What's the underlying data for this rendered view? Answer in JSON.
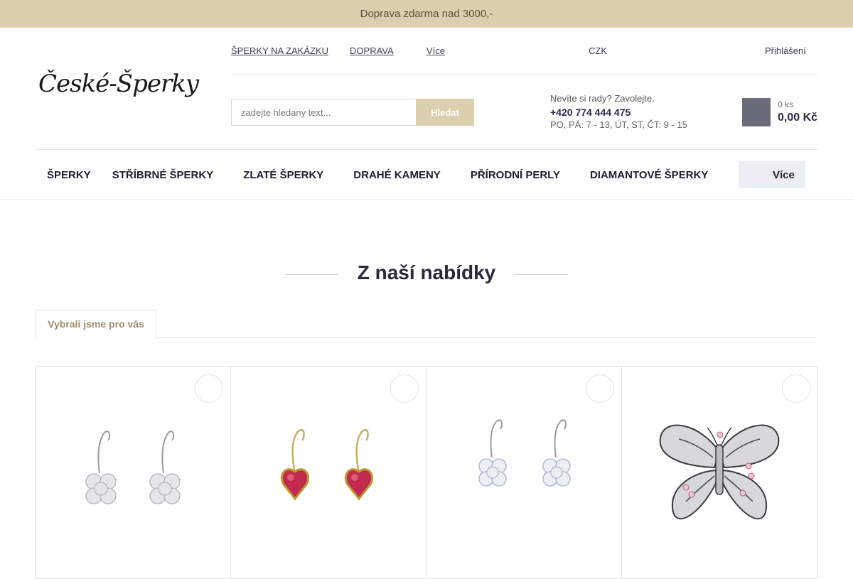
{
  "announcement": {
    "text": "Doprava zdarma nad 3000,-",
    "close_glyph": ""
  },
  "brand": {
    "logo_text": "České-Šperky"
  },
  "top_links": [
    "ŠPERKY NA ZAKÁZKU",
    "DOPRAVA"
  ],
  "top_more": {
    "icon": "",
    "label": "Více"
  },
  "currency": {
    "icon": "",
    "label": "CZK",
    "caret": ""
  },
  "account": {
    "icon1": "",
    "icon2": "",
    "label": "Přihlášení"
  },
  "search": {
    "placeholder": "zadejte hledaný text...",
    "button": "Hledat"
  },
  "contact": {
    "icon": "",
    "question": "Nevíte si rady? Zavolejte.",
    "phone": "+420 774 444 475",
    "hours": "PO, PÁ: 7 - 13, ÚT, ST, ČT: 9 - 15"
  },
  "cart": {
    "icon": "",
    "count": "0 ks",
    "total": "0,00 Kč"
  },
  "nav": {
    "items": [
      {
        "label": "ŠPERKY",
        "arrow": ""
      },
      {
        "label": "STŘÍBRNÉ ŠPERKY",
        "arrow": ""
      },
      {
        "label": "ZLATÉ ŠPERKY",
        "arrow": ""
      },
      {
        "label": "DRAHÉ KAMENY",
        "arrow": ""
      },
      {
        "label": "PŘÍRODNÍ PERLY",
        "arrow": ""
      },
      {
        "label": "DIAMANTOVÉ ŠPERKY",
        "arrow": ""
      }
    ],
    "more": {
      "icon": "",
      "label": "Více"
    }
  },
  "section": {
    "title": "Z naší nabídky",
    "tab": "Vybrali jsme pro vás"
  },
  "products": [
    {
      "fav_icon": ""
    },
    {
      "fav_icon": ""
    },
    {
      "fav_icon": ""
    },
    {
      "fav_icon": ""
    }
  ],
  "colors": {
    "accent": "#dccfae",
    "accent_text": "#a08e68",
    "cart_bg": "#6a6c7a",
    "more_bg": "#eceef6"
  }
}
